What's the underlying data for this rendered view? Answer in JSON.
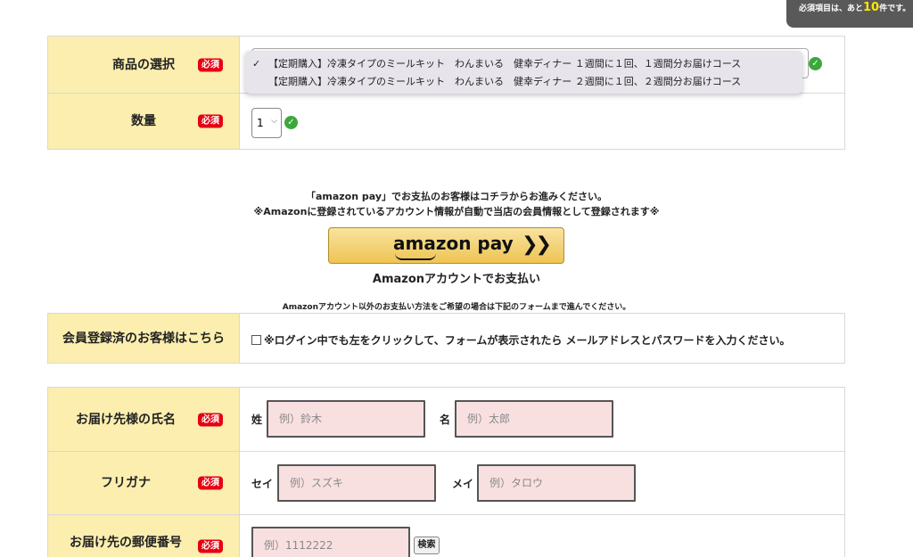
{
  "notice": {
    "prefix": "必須項目は、あと",
    "count": "10",
    "suffix": "件です。"
  },
  "required_badge": "必須",
  "product": {
    "label": "商品の選択",
    "options": [
      "【定期購入】冷凍タイプのミールキット　わんまいる　健幸ディナー １週間に１回、１週間分お届けコース",
      "【定期購入】冷凍タイプのミールキット　わんまいる　健幸ディナー ２週間に１回、２週間分お届けコース"
    ],
    "selected_index": 0
  },
  "quantity": {
    "label": "数量",
    "value": "1"
  },
  "amazon": {
    "line1": "「amazon pay」でお支払のお客様はコチラからお進みください。",
    "line2": "※Amazonに登録されているアカウント情報が自動で当店の会員情報として登録されます※",
    "logo_text": "amazon pay",
    "chevrons": "❯❯",
    "button_caption": "Amazonアカウントでお支払い",
    "other_methods": "Amazonアカウント以外のお支払い方法をご希望の場合は下記のフォームまで進んでください。"
  },
  "member": {
    "label": "会員登録済のお客様はこちら",
    "checkbox_text": "※ログイン中でも左をクリックして、フォームが表示されたら メールアドレスとパスワードを入力ください。"
  },
  "name": {
    "label": "お届け先様の氏名",
    "last_label": "姓",
    "last_placeholder": "例）鈴木",
    "first_label": "名",
    "first_placeholder": "例）太郎"
  },
  "kana": {
    "label": "フリガナ",
    "last_label": "セイ",
    "last_placeholder": "例）スズキ",
    "first_label": "メイ",
    "first_placeholder": "例）タロウ"
  },
  "postal": {
    "label": "お届け先の郵便番号",
    "placeholder": "例）1112222",
    "search_label": "検索"
  }
}
